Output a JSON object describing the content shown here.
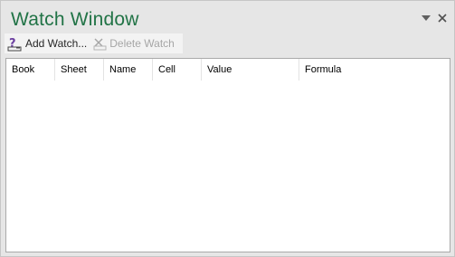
{
  "window": {
    "title": "Watch Window"
  },
  "toolbar": {
    "add_watch_label": "Add Watch...",
    "delete_watch_label": "Delete Watch"
  },
  "table": {
    "columns": [
      "Book",
      "Sheet",
      "Name",
      "Cell",
      "Value",
      "Formula"
    ],
    "rows": []
  },
  "colors": {
    "title": "#217346",
    "background": "#e6e6e6",
    "disabled_text": "#a6a6a6"
  },
  "icons": {
    "options": "triangle-down-icon",
    "close": "close-icon",
    "add_watch": "add-watch-icon",
    "delete_watch": "delete-watch-icon"
  }
}
